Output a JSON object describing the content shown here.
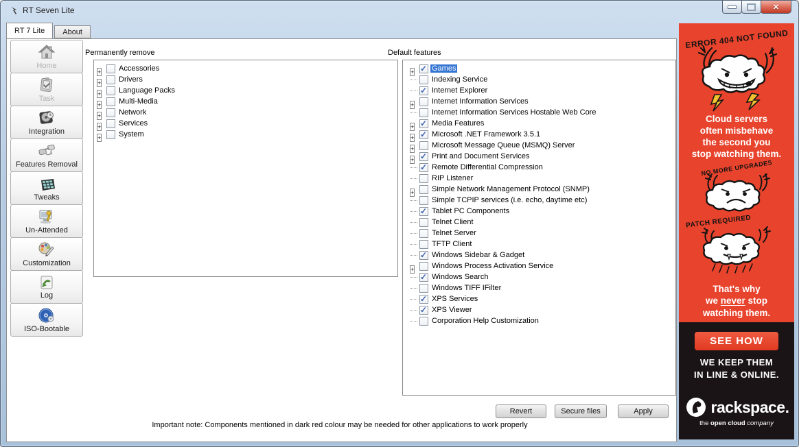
{
  "window": {
    "title": "RT Seven Lite"
  },
  "tabs": {
    "main": "RT 7 Lite",
    "about": "About"
  },
  "sidebar": {
    "items": [
      {
        "label": "Home",
        "disabled": true
      },
      {
        "label": "Task",
        "disabled": true
      },
      {
        "label": "Integration",
        "disabled": false
      },
      {
        "label": "Features Removal",
        "disabled": false
      },
      {
        "label": "Tweaks",
        "disabled": false
      },
      {
        "label": "Un-Attended",
        "disabled": false
      },
      {
        "label": "Customization",
        "disabled": false
      },
      {
        "label": "Log",
        "disabled": false
      },
      {
        "label": "ISO-Bootable",
        "disabled": false
      }
    ]
  },
  "remove_panel": {
    "title": "Permanently remove",
    "items": [
      {
        "label": "Accessories",
        "expandable": true,
        "checked": false
      },
      {
        "label": "Drivers",
        "expandable": true,
        "checked": false
      },
      {
        "label": "Language Packs",
        "expandable": true,
        "checked": false
      },
      {
        "label": "Multi-Media",
        "expandable": true,
        "checked": false
      },
      {
        "label": "Network",
        "expandable": true,
        "checked": false
      },
      {
        "label": "Services",
        "expandable": true,
        "checked": false
      },
      {
        "label": "System",
        "expandable": true,
        "checked": false
      }
    ]
  },
  "features_panel": {
    "title": "Default features",
    "items": [
      {
        "label": "Games",
        "expandable": true,
        "checked": true,
        "selected": true
      },
      {
        "label": "Indexing Service",
        "expandable": false,
        "checked": false
      },
      {
        "label": "Internet Explorer",
        "expandable": false,
        "checked": true
      },
      {
        "label": "Internet Information Services",
        "expandable": true,
        "checked": false
      },
      {
        "label": "Internet Information Services Hostable Web Core",
        "expandable": false,
        "checked": false
      },
      {
        "label": "Media Features",
        "expandable": true,
        "checked": true
      },
      {
        "label": "Microsoft .NET Framework 3.5.1",
        "expandable": true,
        "checked": true
      },
      {
        "label": "Microsoft Message Queue (MSMQ) Server",
        "expandable": true,
        "checked": false
      },
      {
        "label": "Print and Document Services",
        "expandable": true,
        "checked": true
      },
      {
        "label": "Remote Differential Compression",
        "expandable": false,
        "checked": true
      },
      {
        "label": "RIP Listener",
        "expandable": false,
        "checked": false
      },
      {
        "label": "Simple Network Management Protocol (SNMP)",
        "expandable": true,
        "checked": false
      },
      {
        "label": "Simple TCPIP services (i.e. echo, daytime etc)",
        "expandable": false,
        "checked": false
      },
      {
        "label": "Tablet PC Components",
        "expandable": false,
        "checked": true
      },
      {
        "label": "Telnet Client",
        "expandable": false,
        "checked": false
      },
      {
        "label": "Telnet Server",
        "expandable": false,
        "checked": false
      },
      {
        "label": "TFTP Client",
        "expandable": false,
        "checked": false
      },
      {
        "label": "Windows Sidebar & Gadget",
        "expandable": false,
        "checked": true
      },
      {
        "label": "Windows Process Activation Service",
        "expandable": true,
        "checked": false
      },
      {
        "label": "Windows Search",
        "expandable": false,
        "checked": true
      },
      {
        "label": "Windows TIFF IFilter",
        "expandable": false,
        "checked": false
      },
      {
        "label": "XPS Services",
        "expandable": false,
        "checked": true
      },
      {
        "label": "XPS Viewer",
        "expandable": false,
        "checked": true
      },
      {
        "label": "Corporation Help Customization",
        "expandable": false,
        "checked": false
      }
    ]
  },
  "actions": {
    "revert": "Revert",
    "secure": "Secure files",
    "apply": "Apply"
  },
  "note": "Important note: Components mentioned in dark red colour may be needed for other applications to work properly",
  "ad": {
    "error_line": "ERROR 404 NOT FOUND",
    "headline_lines": [
      "Cloud servers",
      "often misbehave",
      "the second you",
      "stop watching them."
    ],
    "upgrades_line": "NO MORE UPGRADES",
    "patch_line": "PATCH REQUIRED",
    "watch1": "That's why",
    "watch2_pre": "we ",
    "watch2_u": "never",
    "watch2_post": " stop",
    "watch3": "watching them.",
    "see_how": "SEE HOW",
    "keep_lines": [
      "WE KEEP THEM",
      "IN LINE & ONLINE."
    ],
    "brand": "rackspace.",
    "brand_tagline_pre": "the ",
    "brand_tagline_bold": "open cloud",
    "brand_tagline_post": " company"
  },
  "colors": {
    "ad_red": "#e8432c",
    "ad_black": "#1b1416",
    "selection_blue": "#3576d2",
    "check_blue": "#3c61b4"
  }
}
